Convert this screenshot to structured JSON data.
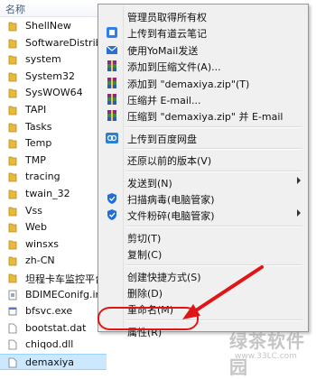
{
  "explorer": {
    "column_header": "名称",
    "items": [
      {
        "name": "ShellNew",
        "type": "folder"
      },
      {
        "name": "SoftwareDistribu",
        "type": "folder"
      },
      {
        "name": "system",
        "type": "folder"
      },
      {
        "name": "System32",
        "type": "folder"
      },
      {
        "name": "SysWOW64",
        "type": "folder"
      },
      {
        "name": "TAPI",
        "type": "folder"
      },
      {
        "name": "Tasks",
        "type": "folder"
      },
      {
        "name": "Temp",
        "type": "folder"
      },
      {
        "name": "TMP",
        "type": "folder"
      },
      {
        "name": "tracing",
        "type": "folder"
      },
      {
        "name": "twain_32",
        "type": "folder"
      },
      {
        "name": "Vss",
        "type": "folder"
      },
      {
        "name": "Web",
        "type": "folder"
      },
      {
        "name": "winsxs",
        "type": "folder"
      },
      {
        "name": "zh-CN",
        "type": "folder"
      },
      {
        "name": "坦程卡车监控平台",
        "type": "folder"
      },
      {
        "name": "BDIMEConifg.ini",
        "type": "ini"
      },
      {
        "name": "bfsvc.exe",
        "type": "exe"
      },
      {
        "name": "bootstat.dat",
        "type": "file"
      },
      {
        "name": "chiqod.dll",
        "type": "file"
      },
      {
        "name": "demaxiya",
        "type": "file",
        "selected": true
      }
    ]
  },
  "context_menu": {
    "items": [
      {
        "label": "管理员取得所有权",
        "icon": "none",
        "submenu": false
      },
      {
        "label": "上传到有道云笔记",
        "icon": "youdao-note-icon",
        "submenu": false
      },
      {
        "label": "使用YoMail发送",
        "icon": "yomail-icon",
        "submenu": false
      },
      {
        "label": "添加到压缩文件(A)...",
        "icon": "winrar-icon",
        "submenu": false
      },
      {
        "label": "添加到 \"demaxiya.zip\"(T)",
        "icon": "winrar-icon",
        "submenu": false
      },
      {
        "label": "压缩并 E-mail...",
        "icon": "winrar-icon",
        "submenu": false
      },
      {
        "label": "压缩到 \"demaxiya.zip\" 并 E-mail",
        "icon": "winrar-icon",
        "submenu": false
      },
      {
        "separator": true
      },
      {
        "label": "上传到百度网盘",
        "icon": "baidu-netdisk-icon",
        "submenu": false
      },
      {
        "separator": true
      },
      {
        "label": "还原以前的版本(V)",
        "icon": "none",
        "submenu": false
      },
      {
        "separator": true
      },
      {
        "label": "发送到(N)",
        "icon": "none",
        "submenu": true
      },
      {
        "label": "扫描病毒(电脑管家)",
        "icon": "pc-manager-shield-icon",
        "submenu": false
      },
      {
        "label": "文件粉碎(电脑管家)",
        "icon": "pc-manager-shield-icon",
        "submenu": true
      },
      {
        "separator": true
      },
      {
        "label": "剪切(T)",
        "icon": "none",
        "submenu": false
      },
      {
        "label": "复制(C)",
        "icon": "none",
        "submenu": false
      },
      {
        "separator": true
      },
      {
        "label": "创建快捷方式(S)",
        "icon": "none",
        "submenu": false
      },
      {
        "label": "删除(D)",
        "icon": "none",
        "submenu": false
      },
      {
        "label": "重命名(M)",
        "icon": "none",
        "submenu": false,
        "highlighted": true
      },
      {
        "separator": true
      },
      {
        "label": "属性(R)",
        "icon": "none",
        "submenu": false
      }
    ]
  },
  "annotation": {
    "highlight_color": "#e01616",
    "arrow_color": "#e01616"
  },
  "watermark": {
    "main": "绿茶软件园",
    "url": "www.33LC.com"
  },
  "colors": {
    "folder": "#e8b93a",
    "selection": "#cce8ff",
    "menu_bg": "#f0f0f0"
  }
}
